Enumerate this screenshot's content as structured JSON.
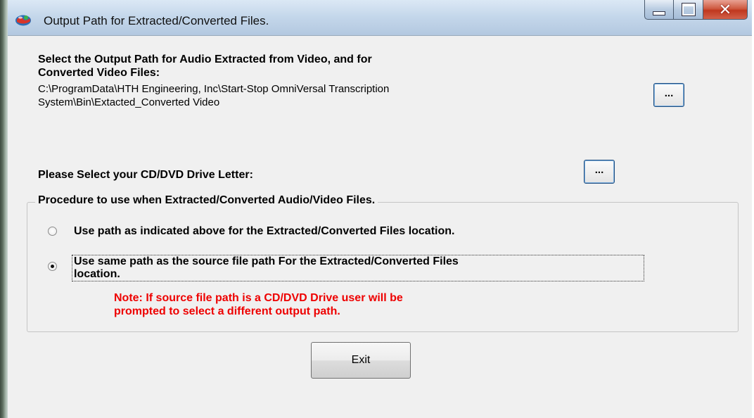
{
  "window": {
    "title": "Output Path for Extracted/Converted Files."
  },
  "output_path": {
    "heading_line1": "Select the Output Path for Audio Extracted from Video, and for",
    "heading_line2": "Converted Video Files:",
    "path_line1": "C:\\ProgramData\\HTH Engineering, Inc\\Start-Stop OmniVersal Transcription",
    "path_line2": "System\\Bin\\Extacted_Converted Video",
    "browse_label": "..."
  },
  "cd_drive": {
    "label": "Please Select your CD/DVD Drive Letter:",
    "browse_label": "..."
  },
  "procedure": {
    "legend": "Procedure to use when Extracted/Converted Audio/Video Files.",
    "option1": "Use path as indicated above for the Extracted/Converted Files location.",
    "option2_line1": "Use same path as the source file path For the Extracted/Converted Files",
    "option2_line2": "location.",
    "selected": "option2",
    "note_line1": "Note: If source file path is a CD/DVD Drive user will be",
    "note_line2": "prompted to select a different output path.",
    "note_color": "#ee0000"
  },
  "exit_label": "Exit"
}
